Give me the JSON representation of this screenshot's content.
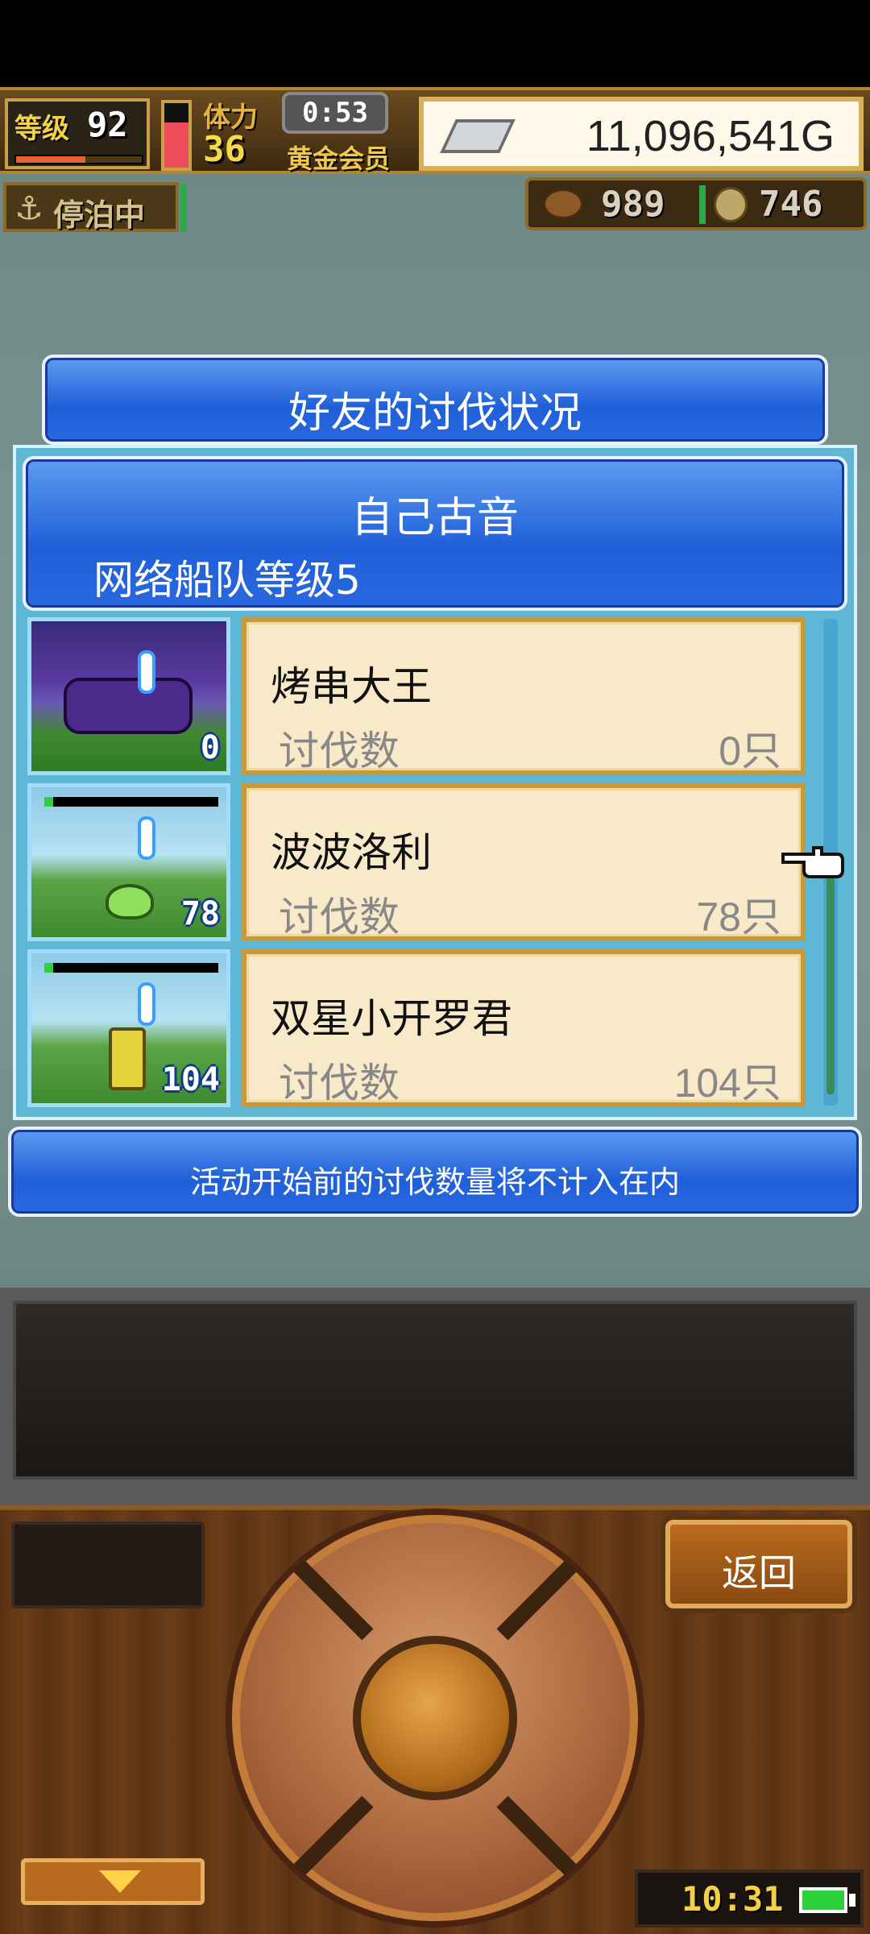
{
  "hud": {
    "level_label": "等级",
    "level_value": "92",
    "level_progress": 0.55,
    "stamina_fraction": 0.7,
    "body_label": "体力",
    "body_value": "36",
    "timer": "0:53",
    "member_label": "黄金会员",
    "money": "11,096,541G",
    "money_icon": "silver-bar-icon"
  },
  "status_row": {
    "anchor_icon": "anchor-icon",
    "anchor_label": "停泊中",
    "resource1_icon": "meat-icon",
    "resource1_value": "989",
    "resource2_icon": "coin-icon",
    "resource2_value": "746"
  },
  "dialog": {
    "title": "好友的讨伐状况",
    "player_name": "自己古音",
    "player_subtitle": "网络船队等级5",
    "rows": [
      {
        "name": "烤串大王",
        "label": "讨伐数",
        "value": "0只",
        "badge": "0",
        "hp": 0.0
      },
      {
        "name": "波波洛利",
        "label": "讨伐数",
        "value": "78只",
        "badge": "78",
        "hp": 0.05
      },
      {
        "name": "双星小开罗君",
        "label": "讨伐数",
        "value": "104只",
        "badge": "104",
        "hp": 0.05
      }
    ],
    "notice": "活动开始前的讨伐数量将不计入在内"
  },
  "controls": {
    "back_label": "返回",
    "clock": "10:31",
    "battery_icon": "battery-icon"
  }
}
